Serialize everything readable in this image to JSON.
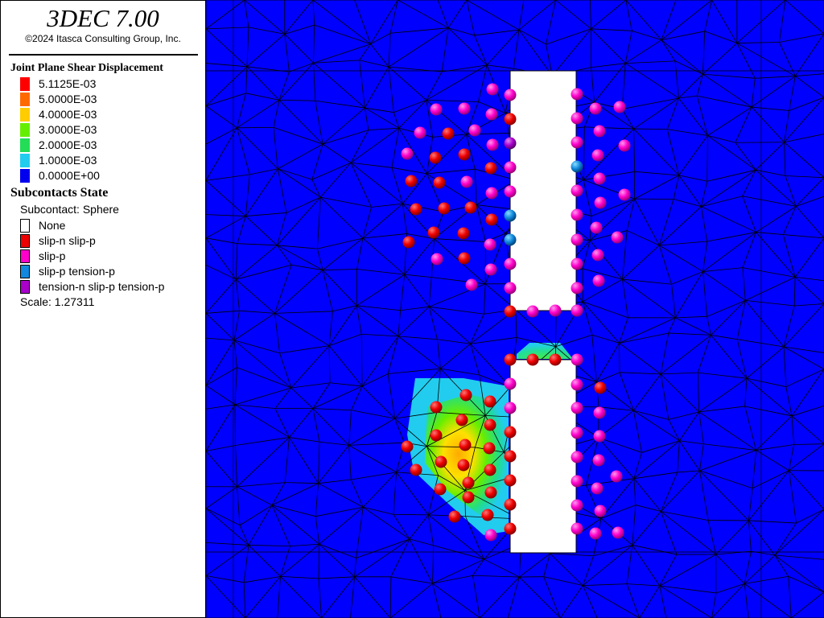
{
  "title": "3DEC 7.00",
  "copyright": "©2024 Itasca Consulting Group, Inc.",
  "shear_legend": {
    "heading": "Joint Plane Shear Displacement",
    "items": [
      {
        "label": "5.1125E-03",
        "color": "#ff0000"
      },
      {
        "label": "5.0000E-03",
        "color": "#ff6a00"
      },
      {
        "label": "4.0000E-03",
        "color": "#ffcc00"
      },
      {
        "label": "3.0000E-03",
        "color": "#66ee00"
      },
      {
        "label": "2.0000E-03",
        "color": "#22dd55"
      },
      {
        "label": "1.0000E-03",
        "color": "#22ccee"
      },
      {
        "label": "0.0000E+00",
        "color": "#0000ee"
      }
    ]
  },
  "state_legend": {
    "heading": "Subcontacts State",
    "subtitle": "Subcontact: Sphere",
    "items": [
      {
        "label": "None",
        "color": "#ffffff"
      },
      {
        "label": "slip-n slip-p",
        "color": "#ee0000"
      },
      {
        "label": "slip-p",
        "color": "#ff00cc"
      },
      {
        "label": "slip-p tension-p",
        "color": "#1188dd"
      },
      {
        "label": "tension-n slip-p tension-p",
        "color": "#aa00cc"
      }
    ],
    "scale": "Scale: 1.27311"
  },
  "colors": {
    "background": "#0000ff",
    "mesh": "#000000",
    "opening": "#ffffff",
    "slip_n_slip_p": "#ee0000",
    "slip_p": "#ff00cc",
    "slip_p_tension_p": "#1188dd",
    "tension_n": "#aa00cc"
  }
}
